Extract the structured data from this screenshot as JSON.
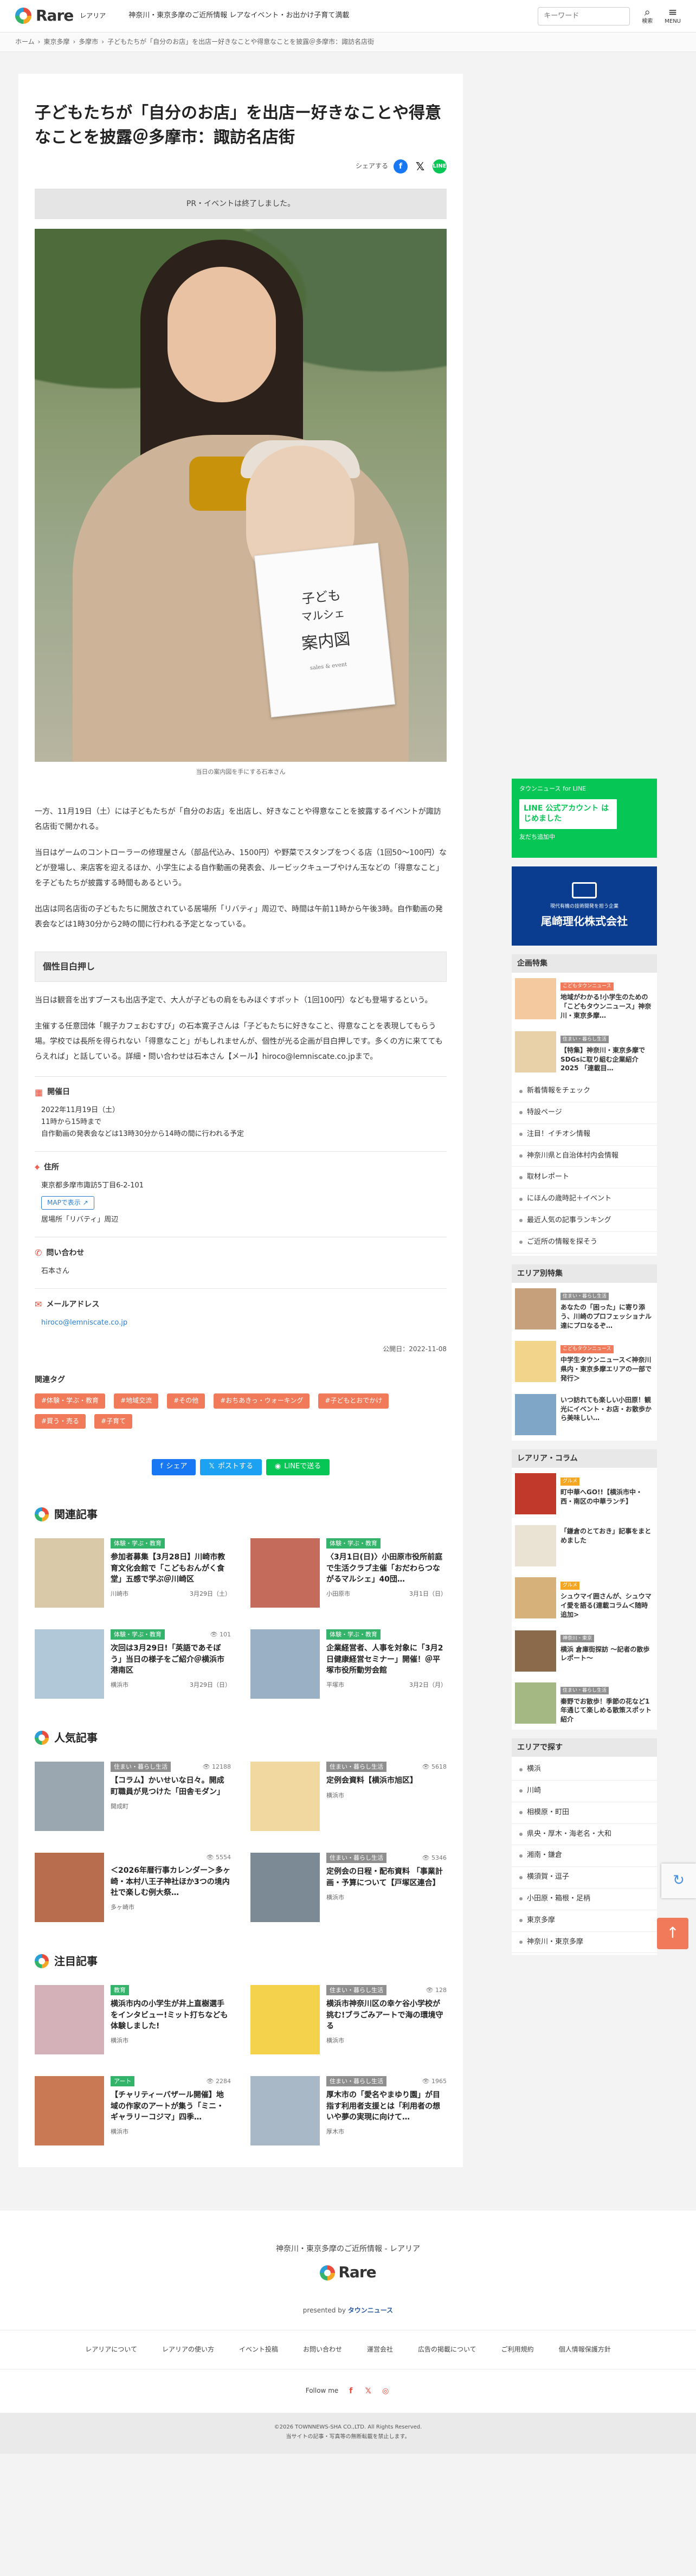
{
  "header": {
    "logo": "Rare",
    "logo_sub": "レアリア",
    "tagline": "神奈川・東京多摩のご近所情報 レアなイベント・お出かけ子育て満載",
    "search_placeholder": "キーワード",
    "search_icon_label": "検索",
    "menu_label": "MENU"
  },
  "breadcrumb": [
    "ホーム",
    "東京多摩",
    "多摩市",
    "子どもたちが「自分のお店」を出店ー好きなことや得意なことを披露＠多摩市：諏訪名店街"
  ],
  "article": {
    "title": "子どもたちが「自分のお店」を出店ー好きなことや得意なことを披露＠多摩市：諏訪名店街",
    "share_label": "シェアする",
    "ended_notice": "PR・イベントは終了しました。",
    "photo_card": {
      "l1": "子ども",
      "l2": "マルシェ",
      "l3": "案内図",
      "l4": "sales & event"
    },
    "photo_caption": "当日の案内図を手にする石本さん",
    "paragraphs": [
      "一方、11月19日（土）には子どもたちが「自分のお店」を出店し、好きなことや得意なことを披露するイベントが諏訪名店街で開かれる。",
      "当日はゲームのコントローラーの修理屋さん（部品代込み、1500円）や野菜でスタンプをつくる店（1回50～100円）などが登場し、来店客を迎えるほか、小学生による自作動画の発表会、ルービックキューブやけん玉などの「得意なこと」を子どもたちが披露する時間もあるという。",
      "出店は同名店街の子どもたちに開放されている居場所「リバティ」周辺で、時間は午前11時から午後3時。自作動画の発表会などは1時30分から2時の間に行われる予定となっている。"
    ],
    "section_head": "個性目白押し",
    "paragraphs2": [
      "当日は観音を出すブースも出店予定で、大人が子どもの肩をもみほぐすポット（1回100円）なども登場するという。",
      "主催する任意団体「親子カフェおむすび」の石本寛子さんは「子どもたちに好きなこと、得意なことを表現してもらう場。学校では長所を得られない「得意なこと」がもしれませんが、個性が光る企画が目白押しです。多くの方に来ててもらえれば」と話している。詳細・問い合わせは石本さん【メール】hiroco@lemniscate.co.jpまで。"
    ],
    "info": {
      "date_label": "開催日",
      "date_lines": [
        "2022年11月19日（土）",
        "11時から15時まで",
        "自作動画の発表会などは13時30分から14時の間に行われる予定"
      ],
      "addr_label": "住所",
      "addr_line": "東京都多摩市諏訪5丁目6-2-101",
      "map_btn": "MAPで表示",
      "addr_note": "居場所「リバティ」周辺",
      "contact_label": "問い合わせ",
      "contact_val": "石本さん",
      "mail_label": "メールアドレス",
      "mail_val": "hiroco@lemniscate.co.jp"
    },
    "pubdate": "公開日：2022-11-08",
    "tags_title": "関連タグ",
    "tags": [
      "#体験・学ぶ・教育",
      "#地域交流",
      "#その他",
      "#おちあきっ・ウォーキング",
      "#子どもとおでかけ",
      "#買う・売る",
      "#子育て"
    ],
    "share_buttons": {
      "fb": "シェア",
      "x": "ポストする",
      "line": "LINEで送る"
    }
  },
  "related": {
    "heading": "関連記事",
    "items": [
      {
        "cat": "体験・学ぶ・教育",
        "cat_color": "#33b46a",
        "title": "参加者募集【3月28日】川崎市教育文化会館で「こどもおんがく食堂」五感で学ぶ＠川崎区",
        "area": "川崎市",
        "date": "3月29日（土）",
        "count": "",
        "thumb": "#d9c9a8"
      },
      {
        "cat": "体験・学ぶ・教育",
        "cat_color": "#33b46a",
        "title": "〈3月1日(日)〉小田原市役所前庭で生活クラブ主催「おだわらつながるマルシェ」40団…",
        "area": "小田原市",
        "date": "3月1日（日）",
        "count": "",
        "thumb": "#c46b5c"
      },
      {
        "cat": "体験・学ぶ・教育",
        "cat_color": "#33b46a",
        "title": "次回は3月29日!「英語であそぼう」当日の様子をご紹介＠横浜市港南区",
        "area": "横浜市",
        "date": "3月29日（日）",
        "count": "101",
        "thumb": "#b1c8d8"
      },
      {
        "cat": "体験・学ぶ・教育",
        "cat_color": "#33b46a",
        "title": "企業経営者、人事を対象に「3月2日健康経営セミナー」開催！＠平塚市役所動労会館",
        "area": "平塚市",
        "date": "3月2日（月）",
        "count": "",
        "thumb": "#9ab0c4"
      }
    ]
  },
  "popular": {
    "heading": "人気記事",
    "items": [
      {
        "cat": "住まい・暮らし生活",
        "cat_color": "#8f8f8f",
        "title": "【コラム】かいせいな日々。開成町職員が見つけた「田舎モダン」",
        "area": "開成町",
        "date": "",
        "count": "12188",
        "thumb": "#9aa6b0"
      },
      {
        "cat": "住まい・暮らし生活",
        "cat_color": "#8f8f8f",
        "title": "定例会資料【横浜市旭区】",
        "area": "横浜市",
        "date": "",
        "count": "5618",
        "thumb": "#f0d8a0"
      },
      {
        "cat": "",
        "cat_color": "#8f8f8f",
        "title": "＜2026年暦行事カレンダー＞多ヶ崎・本村八王子神社ほか3つの境内社で楽しむ例大祭…",
        "area": "多ヶ崎市",
        "date": "",
        "count": "5554",
        "thumb": "#b86d4f"
      },
      {
        "cat": "住まい・暮らし生活",
        "cat_color": "#8f8f8f",
        "title": "定例会の日程・配布資料 「事業計画・予算について【戸塚区連合】",
        "area": "横浜市",
        "date": "",
        "count": "5346",
        "thumb": "#7c8a96"
      }
    ]
  },
  "featured": {
    "heading": "注目記事",
    "items": [
      {
        "cat": "教育",
        "cat_color": "#33b46a",
        "title": "横浜市内の小学生が井上直樹選手をインタビュー!ミット打ちなども体験しました!",
        "area": "横浜市",
        "date": "",
        "count": "",
        "thumb": "#d4b0b8"
      },
      {
        "cat": "住まい・暮らし生活",
        "cat_color": "#8f8f8f",
        "title": "横浜市神奈川区の幸ケ谷小学校が挑む!ブラごみアートで海の環境守る",
        "area": "横浜市",
        "date": "",
        "count": "128",
        "thumb": "#f5d24c"
      },
      {
        "cat": "アート",
        "cat_color": "#33b46a",
        "title": "【チャリティーバザール開催】地域の作家のアートが集う「ミニ・ギャラリーコジマ」四季…",
        "area": "横浜市",
        "date": "",
        "count": "2284",
        "thumb": "#c97a54"
      },
      {
        "cat": "住まい・暮らし生活",
        "cat_color": "#8f8f8f",
        "title": "厚木市の「愛名やまゆり園」が目指す利用者支援とは「利用者の想いや夢の実現に向けて…",
        "area": "厚木市",
        "date": "",
        "count": "1965",
        "thumb": "#a9b8c6"
      }
    ]
  },
  "sidebar": {
    "line_ad": {
      "a1": "タウンニュース for LINE",
      "a2": "LINE 公式アカウント はじめました",
      "a3": "友だち追加中"
    },
    "ozaki_ad": {
      "o1": "現代有機の技術開発を担う企業",
      "o2": "尾崎理化株式会社"
    },
    "feature_heading": "企画特集",
    "features": [
      {
        "cat": "こどもタウンニュース",
        "cat_color": "#f07a5a",
        "title": "地域がわかる!小学生のための「こどもタウンニュース」神奈川・東京多摩…",
        "thumb": "#f5c9a0"
      },
      {
        "cat": "住まい・暮らし生活",
        "cat_color": "#8f8f8f",
        "title": "【特集】神奈川・東京多摩でSDGsに取り組む企業紹介2025 「連載目…",
        "thumb": "#e8d0a8"
      }
    ],
    "links": [
      "新着情報をチェック",
      "特設ページ",
      "注目！イチオシ情報",
      "神奈川県と自治体村内会情報",
      "取材レポート",
      "にほんの歳時記＋イベント",
      "最近人気の記事ランキング",
      "ご近所の情報を探そう"
    ],
    "area_heading": "エリア別特集",
    "area_features": [
      {
        "cat": "住まい・暮らし生活",
        "cat_color": "#8f8f8f",
        "title": "あなたの「困った」に寄り添う、川崎のプロフェッショナル達にプロなるぞ…",
        "thumb": "#c6a07a"
      },
      {
        "cat": "こどもタウンニュース",
        "cat_color": "#f07a5a",
        "title": "中学生タウンニュース＜神奈川県内・東京多摩エリアの一部で発行＞",
        "thumb": "#f2d58a"
      },
      {
        "cat": "",
        "cat_color": "#8f8f8f",
        "title": "いつ訪れても楽しい小田原！観光にイベント・お店・お散歩から美味しい…",
        "thumb": "#7fa6c6"
      }
    ],
    "column_heading": "レアリア・コラム",
    "columns": [
      {
        "cat": "グルメ",
        "cat_color": "#f5a623",
        "title": "町中華へGO!!【横浜市中・西・南区の中華ランチ】",
        "thumb": "#c0392b"
      },
      {
        "cat": "",
        "cat_color": "#8f8f8f",
        "title": "「鎌倉のとておき」記事をまとめました",
        "thumb": "#eae2d2"
      },
      {
        "cat": "グルメ",
        "cat_color": "#f5a623",
        "title": "シュウマイ囲さんが、シュウマイ愛を語る(連載コラム＜随時追加>",
        "thumb": "#d6b17a"
      },
      {
        "cat": "神奈川・東京",
        "cat_color": "#8f8f8f",
        "title": "横浜 倉庫街探訪 ～記者の散歩レポート～",
        "thumb": "#8a6a4a"
      },
      {
        "cat": "住まい・暮らし生活",
        "cat_color": "#8f8f8f",
        "title": "秦野でお散歩！季節の花など1年通じて楽しめる散策スポット紹介",
        "thumb": "#a4b884"
      }
    ],
    "area_search_heading": "エリアで探す",
    "areas": [
      "横浜",
      "川崎",
      "相模原・町田",
      "県央・厚木・海老名・大和",
      "湘南・鎌倉",
      "横須賀・逗子",
      "小田原・箱根・足柄",
      "東京多摩",
      "神奈川・東京多摩"
    ]
  },
  "footer": {
    "tagline": "神奈川・東京多摩のご近所情報 - レアリア",
    "logo": "Rare",
    "presented": "presented by",
    "presented_brand": "タウンニュース",
    "nav": [
      "レアリアについて",
      "レアリアの使い方",
      "イベント投稿",
      "お問い合わせ",
      "運営会社",
      "広告の掲載について",
      "ご利用規約",
      "個人情報保護方針"
    ],
    "follow": "Follow me",
    "copy1": "©2026 TOWNNEWS-SHA CO.,LTD. All Rights Reserved.",
    "copy2": "当サイトの記事・写真等の無断転載を禁止します。"
  }
}
